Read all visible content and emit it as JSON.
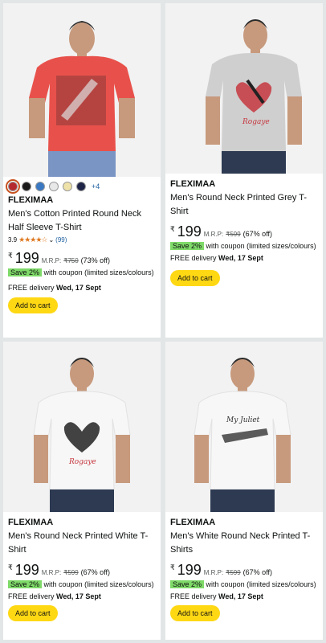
{
  "products": [
    {
      "brand": "FLEXIMAA",
      "title": "Men's Cotton Printed Round Neck Half Sleeve T-Shirt",
      "rating": "3.9",
      "stars": "★★★★☆",
      "rating_count": "(99)",
      "currency": "₹",
      "price": "199",
      "mrp_label": "M.R.P:",
      "mrp": "₹750",
      "discount": "(73% off)",
      "coupon_badge": "Save 2%",
      "coupon_text": "with coupon (limited sizes/colours)",
      "delivery_prefix": "FREE delivery",
      "delivery_date": "Wed, 17 Sept",
      "cart_label": "Add to cart",
      "more_colors": "+4",
      "swatches": [
        "#b52a2f",
        "#1a1a1a",
        "#3a78c2",
        "#e8e8e8",
        "#efe2a8",
        "#1f2547"
      ],
      "shirt_color": "#e8514b"
    },
    {
      "brand": "FLEXIMAA",
      "title": "Men's Round Neck Printed Grey T-Shirt",
      "currency": "₹",
      "price": "199",
      "mrp_label": "M.R.P:",
      "mrp": "₹599",
      "discount": "(67% off)",
      "coupon_badge": "Save 2%",
      "coupon_text": "with coupon (limited sizes/colours)",
      "delivery_prefix": "FREE delivery",
      "delivery_date": "Wed, 17 Sept",
      "cart_label": "Add to cart",
      "shirt_color": "#cfcfcf"
    },
    {
      "brand": "FLEXIMAA",
      "title": "Men's Round Neck Printed White T-Shirt",
      "currency": "₹",
      "price": "199",
      "mrp_label": "M.R.P:",
      "mrp": "₹599",
      "discount": "(67% off)",
      "coupon_badge": "Save 2%",
      "coupon_text": "with coupon (limited sizes/colours)",
      "delivery_prefix": "FREE delivery",
      "delivery_date": "Wed, 17 Sept",
      "cart_label": "Add to cart",
      "shirt_color": "#f7f7f7"
    },
    {
      "brand": "FLEXIMAA",
      "title": "Men's White Round Neck Printed T-Shirts",
      "currency": "₹",
      "price": "199",
      "mrp_label": "M.R.P:",
      "mrp": "₹599",
      "discount": "(67% off)",
      "coupon_badge": "Save 2%",
      "coupon_text": "with coupon (limited sizes/colours)",
      "delivery_prefix": "FREE delivery",
      "delivery_date": "Wed, 17 Sept",
      "cart_label": "Add to cart",
      "shirt_color": "#f7f7f7"
    }
  ]
}
